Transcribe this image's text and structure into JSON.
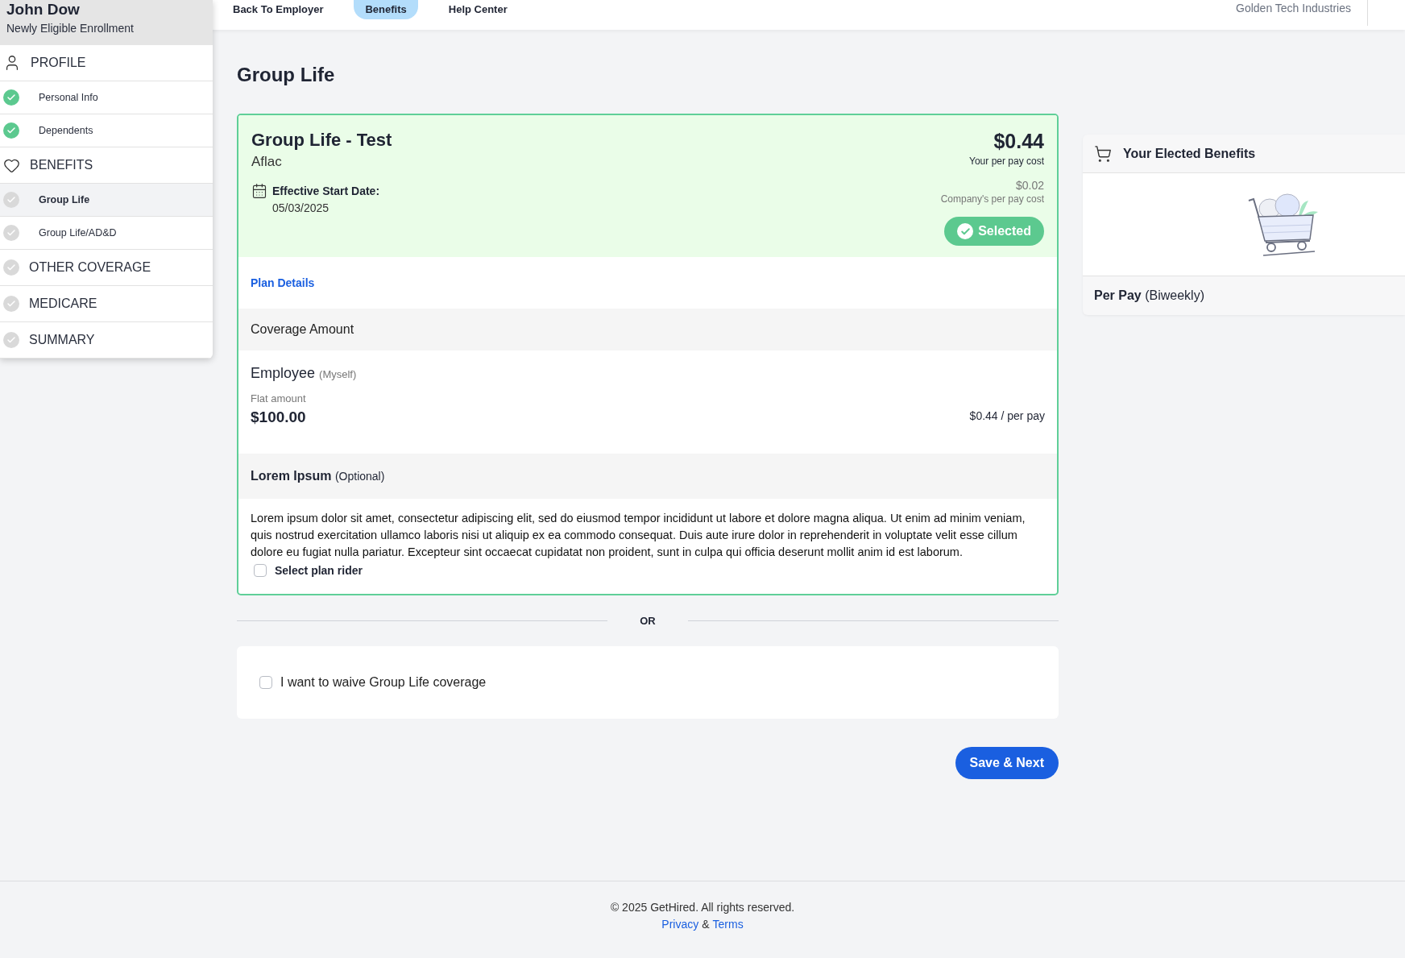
{
  "header": {
    "nav": [
      {
        "label": "Back To Employer",
        "selected": false
      },
      {
        "label": "Benefits",
        "selected": true
      },
      {
        "label": "Help Center",
        "selected": false
      }
    ],
    "company": "Golden Tech Industries"
  },
  "sidebar": {
    "name": "John Dow",
    "subtitle": "Newly Eligible Enrollment",
    "sections": [
      {
        "label": "PROFILE",
        "kind": "person",
        "children": [
          {
            "label": "Personal Info",
            "completed": true,
            "selected": false
          },
          {
            "label": "Dependents",
            "completed": true,
            "selected": false
          }
        ]
      },
      {
        "label": "BENEFITS",
        "kind": "heart",
        "children": [
          {
            "label": "Group Life",
            "completed": false,
            "selected": true
          },
          {
            "label": "Group Life/AD&D",
            "completed": false,
            "selected": false
          }
        ]
      },
      {
        "label": "OTHER COVERAGE",
        "kind": "step",
        "completed": false
      },
      {
        "label": "MEDICARE",
        "kind": "step",
        "completed": false
      },
      {
        "label": "SUMMARY",
        "kind": "step",
        "completed": false
      }
    ]
  },
  "page_title": "Group Life",
  "plan": {
    "title": "Group Life - Test",
    "carrier": "Aflac",
    "effective_label": "Effective Start Date:",
    "effective_date": "05/03/2025",
    "price": "$0.44",
    "price_label": "Your per pay cost",
    "company_price": "$0.02",
    "company_label": "Company's per pay cost",
    "select_button": {
      "label": "Selected",
      "selected": true
    },
    "plan_details": "Plan Details",
    "coverage_header": "Coverage Amount",
    "employee": {
      "label": "Employee",
      "note": "(Myself)",
      "amount_label": "Flat amount",
      "amount": "$100.00",
      "per_pay": "$0.44 / per pay"
    },
    "rider": {
      "title": "Lorem Ipsum",
      "note": "(Optional)",
      "text": "Lorem ipsum dolor sit amet, consectetur adipiscing elit, sed do eiusmod tempor incididunt ut labore et dolore magna aliqua. Ut enim ad minim veniam, quis nostrud exercitation ullamco laboris nisi ut aliquip ex ea commodo consequat. Duis aute irure dolor in reprehenderit in voluptate velit esse cillum dolore eu fugiat nulla pariatur. Excepteur sint occaecat cupidatat non proident, sunt in culpa qui officia deserunt mollit anim id est laborum.",
      "checkbox_label": "Select plan rider",
      "checked": false
    }
  },
  "or": "OR",
  "waive": {
    "label": "I want to waive Group Life coverage",
    "checked": false
  },
  "save_button": "Save & Next",
  "elected": {
    "title": "Your Elected Benefits",
    "per_pay_label": "Per Pay",
    "per_pay_note": "(Biweekly)"
  },
  "footer": {
    "copyright": "© 2025 GetHired. All rights reserved.",
    "privacy": "Privacy",
    "and": "&",
    "terms": "Terms"
  }
}
